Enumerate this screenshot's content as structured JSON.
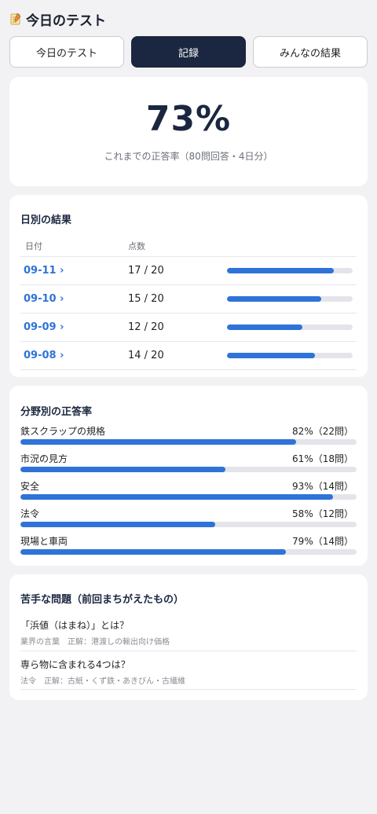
{
  "header": {
    "title": "今日のテスト",
    "icon": "memo-icon"
  },
  "tabs": [
    {
      "label": "今日のテスト",
      "active": false
    },
    {
      "label": "記録",
      "active": true
    },
    {
      "label": "みんなの結果",
      "active": false
    }
  ],
  "summary": {
    "rate": "73%",
    "note": "これまでの正答率（80問回答・4日分）"
  },
  "daily": {
    "title": "日別の結果",
    "col_date": "日付",
    "col_score": "点数",
    "rows": [
      {
        "date": "09-11 ›",
        "score": "17 / 20",
        "ratio": 0.85
      },
      {
        "date": "09-10 ›",
        "score": "15 / 20",
        "ratio": 0.75
      },
      {
        "date": "09-09 ›",
        "score": "12 / 20",
        "ratio": 0.6
      },
      {
        "date": "09-08 ›",
        "score": "14 / 20",
        "ratio": 0.7
      }
    ]
  },
  "fields": {
    "title": "分野別の正答率",
    "rows": [
      {
        "name": "鉄スクラップの規格",
        "value": "82%（22問）",
        "ratio": 0.82
      },
      {
        "name": "市況の見方",
        "value": "61%（18問）",
        "ratio": 0.61
      },
      {
        "name": "安全",
        "value": "93%（14問）",
        "ratio": 0.93
      },
      {
        "name": "法令",
        "value": "58%（12問）",
        "ratio": 0.58
      },
      {
        "name": "現場と車両",
        "value": "79%（14問）",
        "ratio": 0.79
      }
    ]
  },
  "weak": {
    "title": "苦手な問題（前回まちがえたもの）",
    "items": [
      {
        "question": "「浜値（はまね）」とは？",
        "detail": "業界の言葉　正解：港渡しの輸出向け価格"
      },
      {
        "question": "専ら物に含まれる4つは？",
        "detail": "法令　正解：古紙・くず鉄・あきびん・古繊維"
      }
    ]
  },
  "colors": {
    "accent": "#2f73d8",
    "navy": "#1b2740",
    "track": "#e3e5ea"
  }
}
